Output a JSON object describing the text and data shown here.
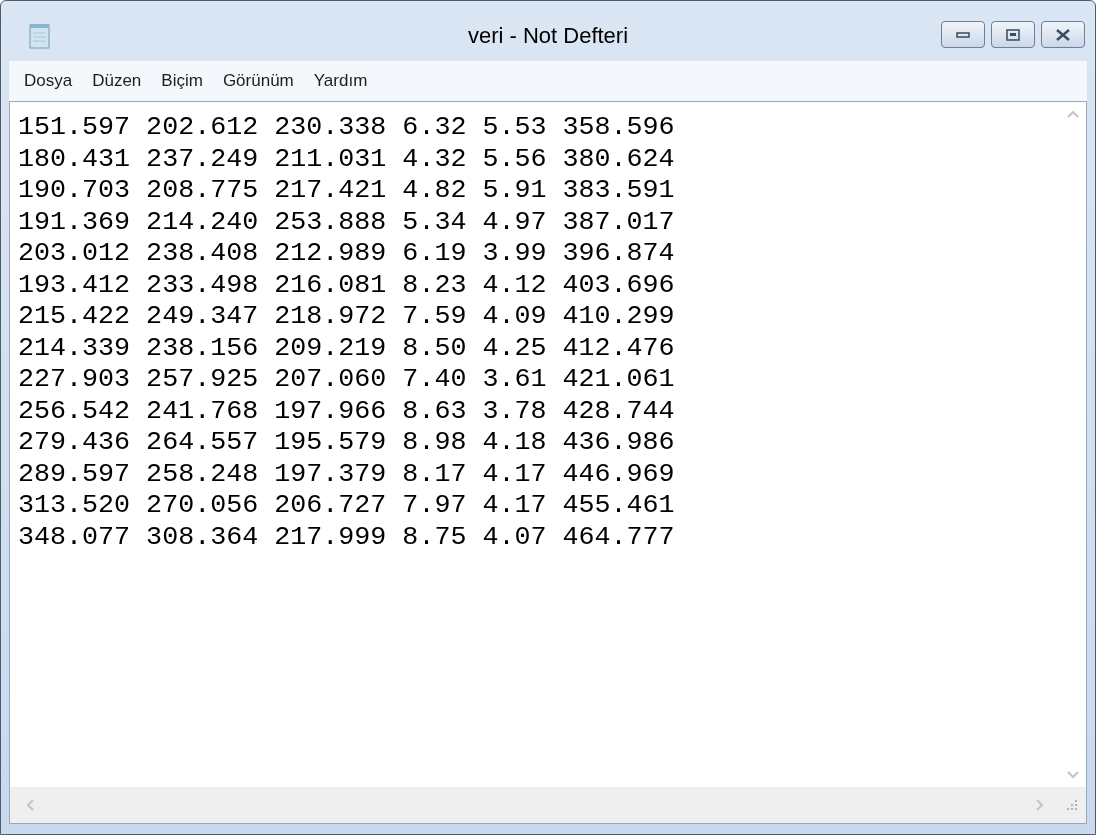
{
  "window": {
    "title": "veri - Not Defteri"
  },
  "menu": [
    "Dosya",
    "Düzen",
    "Biçim",
    "Görünüm",
    "Yardım"
  ],
  "lines": [
    "151.597 202.612 230.338 6.32 5.53 358.596",
    "180.431 237.249 211.031 4.32 5.56 380.624",
    "190.703 208.775 217.421 4.82 5.91 383.591",
    "191.369 214.240 253.888 5.34 4.97 387.017",
    "203.012 238.408 212.989 6.19 3.99 396.874",
    "193.412 233.498 216.081 8.23 4.12 403.696",
    "215.422 249.347 218.972 7.59 4.09 410.299",
    "214.339 238.156 209.219 8.50 4.25 412.476",
    "227.903 257.925 207.060 7.40 3.61 421.061",
    "256.542 241.768 197.966 8.63 3.78 428.744",
    "279.436 264.557 195.579 8.98 4.18 436.986",
    "289.597 258.248 197.379 8.17 4.17 446.969",
    "313.520 270.056 206.727 7.97 4.17 455.461",
    "348.077 308.364 217.999 8.75 4.07 464.777"
  ]
}
